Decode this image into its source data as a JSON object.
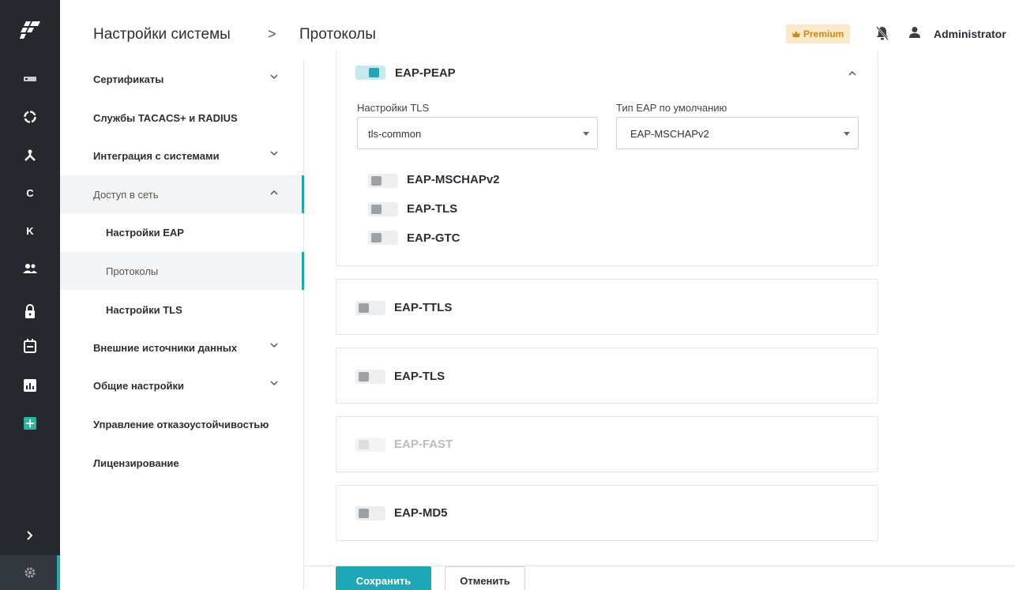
{
  "header": {
    "breadcrumb_root": "Настройки системы",
    "breadcrumb_sep": ">",
    "breadcrumb_page": "Протоколы",
    "premium_label": "Premium",
    "username": "Administrator"
  },
  "rail": {
    "letter_c": "C",
    "letter_k": "K",
    "icons": [
      "logo-icon",
      "server-icon",
      "circle-icon",
      "network-icon",
      "c-letter",
      "k-letter",
      "users-icon",
      "lock-icon",
      "calendar-icon",
      "chart-icon",
      "plus-icon",
      "expand-icon",
      "settings-icon"
    ]
  },
  "sidebar": {
    "items": [
      {
        "label": "Сертификаты"
      },
      {
        "label": "Службы TACACS+ и RADIUS"
      },
      {
        "label": "Интеграция с системами"
      },
      {
        "label": "Доступ в сеть"
      },
      {
        "label": "Настройки EAP"
      },
      {
        "label": "Протоколы"
      },
      {
        "label": "Настройки TLS"
      },
      {
        "label": "Внешние источники данных"
      },
      {
        "label": "Общие настройки"
      },
      {
        "label": "Управление отказоустойчивостью"
      },
      {
        "label": "Лицензирование"
      }
    ]
  },
  "peap": {
    "title": "EAP-PEAP",
    "enabled": true,
    "tls_settings_label": "Настройки TLS",
    "tls_settings_value": "tls-common",
    "default_eap_label": "Тип EAP по умолчанию",
    "default_eap_value": "EAP-MSCHAPv2",
    "inner": [
      {
        "label": "EAP-MSCHAPv2",
        "enabled": false
      },
      {
        "label": "EAP-TLS",
        "enabled": false
      },
      {
        "label": "EAP-GTC",
        "enabled": false
      }
    ]
  },
  "protocols": [
    {
      "label": "EAP-TTLS",
      "enabled": false,
      "disabled": false
    },
    {
      "label": "EAP-TLS",
      "enabled": false,
      "disabled": false
    },
    {
      "label": "EAP-FAST",
      "enabled": false,
      "disabled": true
    },
    {
      "label": "EAP-MD5",
      "enabled": false,
      "disabled": false
    }
  ],
  "footer": {
    "save_label": "Сохранить",
    "cancel_label": "Отменить"
  },
  "colors": {
    "accent": "#1fa7b8",
    "rail_bg": "#25292e",
    "premium_bg": "#fbe9c9",
    "premium_text": "#c98a12"
  }
}
